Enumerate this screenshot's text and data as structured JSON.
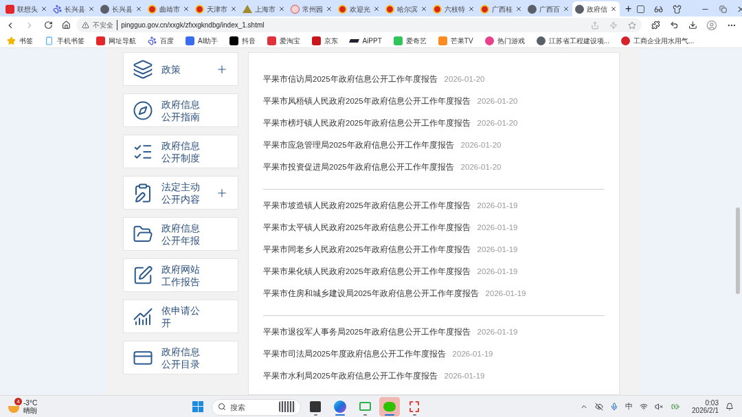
{
  "browser": {
    "tabs": [
      {
        "title": "联想头",
        "kind": "red",
        "selected": false
      },
      {
        "title": "长兴县",
        "kind": "paw",
        "selected": false
      },
      {
        "title": "长兴县",
        "kind": "e",
        "selected": false
      },
      {
        "title": "曲靖市",
        "kind": "emblem",
        "selected": false
      },
      {
        "title": "天津市",
        "kind": "emblem",
        "selected": false
      },
      {
        "title": "上海市",
        "kind": "mountain",
        "selected": false
      },
      {
        "title": "常州园",
        "kind": "seal",
        "selected": false
      },
      {
        "title": "欢迎光",
        "kind": "emblem",
        "selected": false
      },
      {
        "title": "哈尔滨",
        "kind": "emblem",
        "selected": false
      },
      {
        "title": "六枝特",
        "kind": "emblem",
        "selected": false
      },
      {
        "title": "广西桂",
        "kind": "emblem",
        "selected": false
      },
      {
        "title": "广西百",
        "kind": "e",
        "selected": false
      },
      {
        "title": "政府信",
        "kind": "e",
        "selected": true
      }
    ],
    "new_tab": "+",
    "address": {
      "security": "不安全",
      "url": "pingguo.gov.cn/xxgk/zfxxgkndbg/index_1.shtml"
    },
    "bookmarks": [
      {
        "label": "书签",
        "kind": "star"
      },
      {
        "label": "手机书签",
        "kind": "phone"
      },
      {
        "label": "网址导航",
        "kind": "red"
      },
      {
        "label": "百度",
        "kind": "paw"
      },
      {
        "label": "AI助手",
        "kind": "ai"
      },
      {
        "label": "抖音",
        "kind": "tiktok"
      },
      {
        "label": "爱淘宝",
        "kind": "tao"
      },
      {
        "label": "京东",
        "kind": "jd"
      },
      {
        "label": "AiPPT",
        "kind": "ppt"
      },
      {
        "label": "爱奇艺",
        "kind": "iqiyi"
      },
      {
        "label": "芒果TV",
        "kind": "mango"
      },
      {
        "label": "热门游戏",
        "kind": "game"
      },
      {
        "label": "江苏省工程建设项...",
        "kind": "e"
      },
      {
        "label": "工商企业用水用气...",
        "kind": "gs"
      }
    ]
  },
  "sidebar": {
    "items": [
      {
        "label": "政策",
        "kind": "layers",
        "expandable": true
      },
      {
        "label": "政府信息公开指南",
        "kind": "compass",
        "expandable": false
      },
      {
        "label": "政府信息公开制度",
        "kind": "list",
        "expandable": false
      },
      {
        "label": "法定主动公开内容",
        "kind": "clipboard",
        "expandable": true
      },
      {
        "label": "政府信息公开年报",
        "kind": "folder",
        "expandable": false
      },
      {
        "label": "政府网站工作报告",
        "kind": "pen",
        "expandable": false
      },
      {
        "label": "依申请公开",
        "kind": "chart",
        "expandable": false
      },
      {
        "label": "政府信息公开目录",
        "kind": "card",
        "expandable": false
      }
    ]
  },
  "reports": {
    "groups": [
      {
        "items": [
          {
            "title": "平果市信访局2025年政府信息公开工作年度报告",
            "date": "2026-01-20"
          },
          {
            "title": "平果市凤梧镇人民政府2025年政府信息公开工作年度报告",
            "date": "2026-01-20"
          },
          {
            "title": "平果市榜圩镇人民政府2025年政府信息公开工作年度报告",
            "date": "2026-01-20"
          },
          {
            "title": "平果市应急管理局2025年政府信息公开工作年度报告",
            "date": "2026-01-20"
          },
          {
            "title": "平果市投资促进局2025年政府信息公开工作年度报告",
            "date": "2026-01-20"
          }
        ]
      },
      {
        "items": [
          {
            "title": "平果市坡造镇人民政府2025年政府信息公开工作年度报告",
            "date": "2026-01-19"
          },
          {
            "title": "平果市太平镇人民政府2025年政府信息公开工作年度报告",
            "date": "2026-01-19"
          },
          {
            "title": "平果市同老乡人民政府2025年政府信息公开工作年度报告",
            "date": "2026-01-19"
          },
          {
            "title": "平果市果化镇人民政府2025年政府信息公开工作年度报告",
            "date": "2026-01-19"
          },
          {
            "title": "平果市住房和城乡建设局2025年政府信息公开工作年度报告",
            "date": "2026-01-19"
          }
        ]
      },
      {
        "items": [
          {
            "title": "平果市退役军人事务局2025年政府信息公开工作年度报告",
            "date": "2026-01-19"
          },
          {
            "title": "平果市司法局2025年度政府信息公开工作年度报告",
            "date": "2026-01-19"
          },
          {
            "title": "平果市水利局2025年政府信息公开工作年度报告",
            "date": "2026-01-19"
          }
        ]
      }
    ]
  },
  "taskbar": {
    "weather": {
      "badge": "4",
      "temperature": "-3°C",
      "condition": "晴朗"
    },
    "search": {
      "placeholder": "搜索"
    },
    "apps": [
      {
        "kind": "files",
        "active": false
      },
      {
        "kind": "edge",
        "active": true
      },
      {
        "kind": "remote",
        "active": false
      },
      {
        "kind": "wechat",
        "active": true
      },
      {
        "kind": "snip",
        "active": false
      }
    ],
    "ime": "中",
    "time": "0:03",
    "date": "2026/2/1"
  }
}
